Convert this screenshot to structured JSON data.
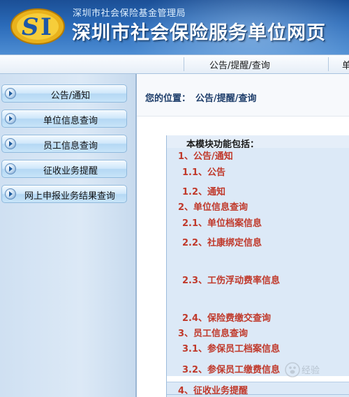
{
  "header": {
    "agency_name": "深圳市社会保险基金管理局",
    "site_title": "深圳市社会保险服务单位网页"
  },
  "menubar": {
    "items": [
      "公告/提醒/查询",
      "单"
    ]
  },
  "sidebar": {
    "items": [
      {
        "label": "公告/通知"
      },
      {
        "label": "单位信息查询"
      },
      {
        "label": "员工信息查询"
      },
      {
        "label": "征收业务提醒"
      },
      {
        "label": "网上申报业务结果查询"
      }
    ]
  },
  "main": {
    "location_label": "您的位置：",
    "location_value": "公告/提醒/查询",
    "table_title": "本模块功能包括：",
    "rows": [
      {
        "text": "1、公告/通知"
      },
      {
        "text": "1.1、公告"
      },
      {
        "text": "1.2、通知"
      },
      {
        "text": "2、单位信息查询"
      },
      {
        "text": "2.1、单位档案信息"
      },
      {
        "text": "2.2、社康绑定信息"
      },
      {
        "text": "2.3、工伤浮动费率信息"
      },
      {
        "text": "2.4、保险费缴交查询"
      },
      {
        "text": "3、员工信息查询"
      },
      {
        "text": "3.1、参保员工档案信息"
      },
      {
        "text": "3.2、参保员工缴费信息"
      },
      {
        "text": "4、征收业务提醒"
      }
    ]
  },
  "colors": {
    "header_blue": "#2a6ab8",
    "section_text": "#c0392b",
    "sidebar_bg": "#cfe0f2"
  },
  "icons": {
    "logo": "si-logo",
    "nav_bullet": "play-bullet-icon",
    "watermark": "paw-icon"
  },
  "watermark": {
    "text": "经验"
  }
}
